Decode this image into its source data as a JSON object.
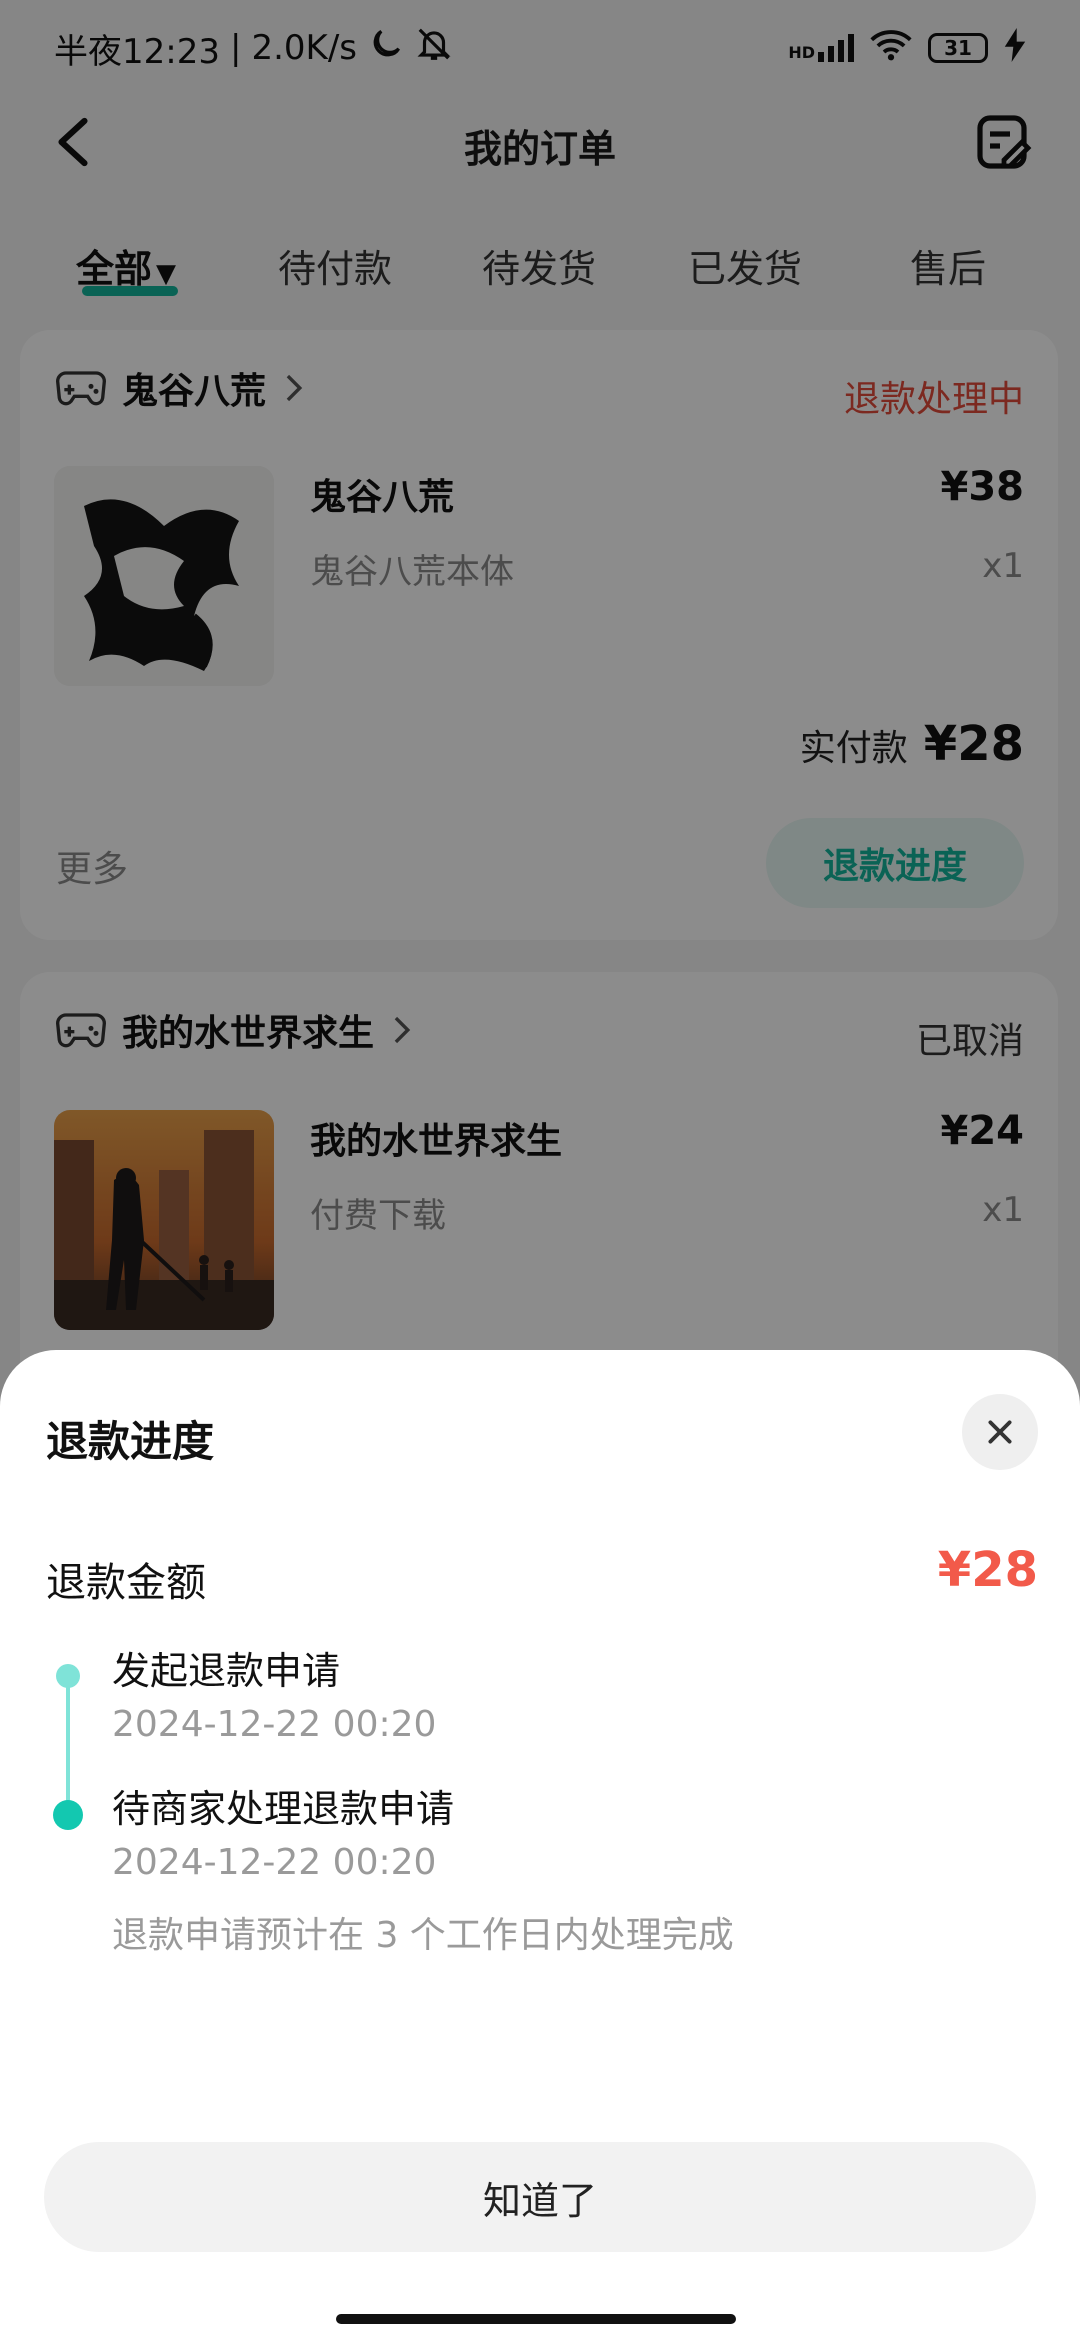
{
  "status_bar": {
    "time_label": "半夜12:23",
    "network_speed": "2.0K/s",
    "hd_label": "HD",
    "battery_level": "31"
  },
  "header": {
    "title": "我的订单"
  },
  "tabs": [
    {
      "label": "全部",
      "active": true
    },
    {
      "label": "待付款"
    },
    {
      "label": "待发货"
    },
    {
      "label": "已发货"
    },
    {
      "label": "售后"
    }
  ],
  "orders": [
    {
      "shop": "鬼谷八荒",
      "status": "退款处理中",
      "product_name": "鬼谷八荒",
      "product_desc": "鬼谷八荒本体",
      "price": "¥38",
      "qty": "x1",
      "paid_label": "实付款",
      "paid_value": "¥28",
      "more_label": "更多",
      "action_label": "退款进度"
    },
    {
      "shop": "我的水世界求生",
      "status": "已取消",
      "product_name": "我的水世界求生",
      "product_desc": "付费下载",
      "price": "¥24",
      "qty": "x1"
    }
  ],
  "refund_sheet": {
    "title": "退款进度",
    "amount_label": "退款金额",
    "amount_value": "¥28",
    "steps": [
      {
        "title": "发起退款申请",
        "time": "2024-12-22   00:20"
      },
      {
        "title": "待商家处理退款申请",
        "time": "2024-12-22   00:20",
        "note": "退款申请预计在 3 个工作日内处理完成"
      }
    ],
    "confirm_label": "知道了"
  },
  "colors": {
    "accent": "#13b59c",
    "refund_red": "#f25a4a",
    "status_red": "#e24b3b"
  }
}
